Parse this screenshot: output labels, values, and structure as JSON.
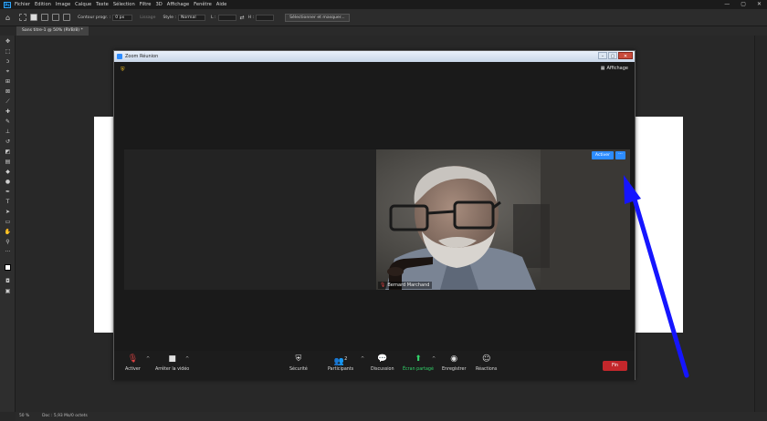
{
  "photoshop": {
    "logo": "Ps",
    "menu": [
      "Fichier",
      "Edition",
      "Image",
      "Calque",
      "Texte",
      "Sélection",
      "Filtre",
      "3D",
      "Affichage",
      "Fenêtre",
      "Aide"
    ],
    "window_controls": {
      "minimize": "—",
      "maximize": "▢",
      "close": "✕"
    },
    "options_bar": {
      "feather_label": "Contour progr. :",
      "feather_value": "0 px",
      "antialias_label": "Lissage",
      "style_label": "Style :",
      "style_value": "Normal",
      "width_label": "L :",
      "height_label": "H :",
      "select_mask_button": "Sélectionner et masquer..."
    },
    "document_tab": "Sans titre-1 @ 50% (RVB/8) *",
    "status_bar": {
      "zoom": "50 %",
      "doc_info": "Doc : 5,93 Mo/0 octets"
    }
  },
  "zoom": {
    "title": "Zoom Réunion",
    "view_button": "Affichage",
    "participant_name": "Bernard Marchand",
    "activate_button": "Activer",
    "more_button": "···",
    "toolbar": {
      "unmute": "Activer",
      "start_video": "Arrêter la vidéo",
      "security": "Sécurité",
      "participants": "Participants",
      "participants_count": "2",
      "chat": "Discussion",
      "share_screen": "Écran partagé",
      "record": "Enregistrer",
      "reactions": "Réactions",
      "end": "Fin"
    },
    "colors": {
      "accent": "#2d8cff",
      "end": "#c3272b",
      "share": "#32d36a"
    }
  },
  "annotation": {
    "arrow_color": "#1515ff"
  }
}
